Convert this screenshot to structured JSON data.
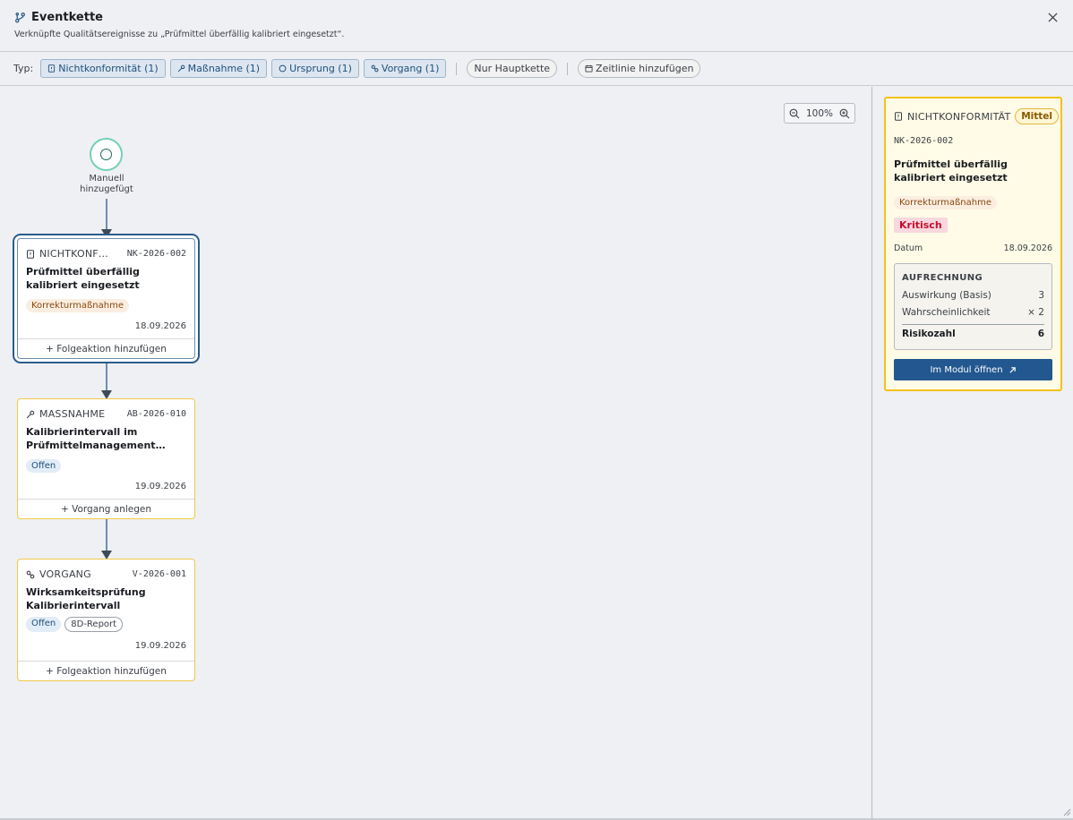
{
  "header": {
    "title": "Eventkette",
    "subtitle": "Verknüpfte Qualitätsereignisse zu „Prüfmittel überfällig kalibriert eingesetzt“."
  },
  "toolbar": {
    "typ_label": "Typ:",
    "filters": [
      {
        "label": "Nichtkonformität (1)",
        "icon": "doc-alert-icon"
      },
      {
        "label": "Maßnahme (1)",
        "icon": "wrench-icon"
      },
      {
        "label": "Ursprung (1)",
        "icon": "circle-icon"
      },
      {
        "label": "Vorgang (1)",
        "icon": "link-icon"
      }
    ],
    "main_chain": "Nur Hauptkette",
    "add_timeline": "Zeitlinie hinzufügen"
  },
  "canvas": {
    "zoom": "100%",
    "start_label": "Manuell hinzugefügt",
    "cards": [
      {
        "kind": "NICHTKONF…",
        "id": "NK-2026-002",
        "title": "Prüfmittel überfällig kalibriert eingesetzt",
        "tags": [
          "Korrekturmaßnahme"
        ],
        "date": "18.09.2026",
        "footer": "+ Folgeaktion hinzufügen"
      },
      {
        "kind": "MASSNAHME",
        "id": "AB-2026-010",
        "title": "Kalibrierintervall im Prüfmittelmanagement…",
        "tags": [
          "Offen"
        ],
        "date": "19.09.2026",
        "footer": "+ Vorgang anlegen"
      },
      {
        "kind": "VORGANG",
        "id": "V-2026-001",
        "title": "Wirksamkeitsprüfung Kalibrierintervall",
        "tags": [
          "Offen",
          "8D-Report"
        ],
        "date": "19.09.2026",
        "footer": "+ Folgeaktion hinzufügen"
      }
    ]
  },
  "detail": {
    "kind": "NICHTKONFORMITÄT",
    "severity": "Mittel",
    "id": "NK-2026-002",
    "title": "Prüfmittel überfällig kalibriert eingesetzt",
    "tag": "Korrekturmaßnahme",
    "criticality": "Kritisch",
    "date_label": "Datum",
    "date": "18.09.2026",
    "calc": {
      "title": "AUFRECHNUNG",
      "impact_label": "Auswirkung (Basis)",
      "impact_value": "3",
      "prob_label": "Wahrscheinlichkeit",
      "prob_value": "× 2",
      "total_label": "Risikozahl",
      "total_value": "6"
    },
    "open_button": "Im Modul öffnen"
  },
  "colors": {
    "accent": "#22578f",
    "highlight": "#f2c21b",
    "critical": "#c4102f",
    "start_ring": "#74d0b7"
  }
}
